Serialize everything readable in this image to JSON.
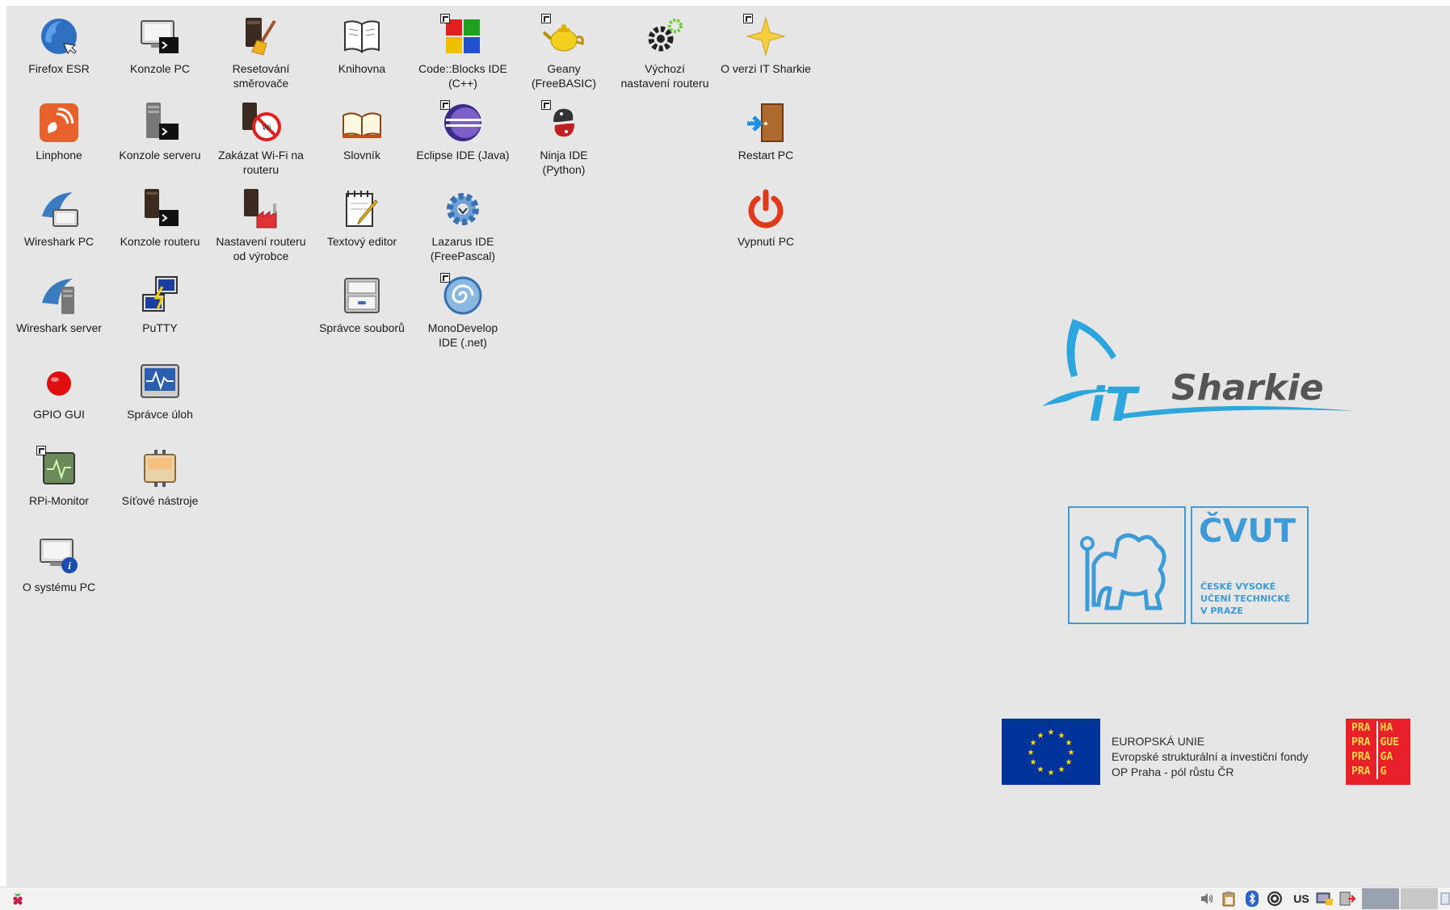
{
  "desktop": {
    "icons": [
      {
        "id": "firefox",
        "label": "Firefox ESR",
        "icon": "firefox-icon"
      },
      {
        "id": "console-pc",
        "label": "Konzole PC",
        "icon": "monitor-terminal-icon"
      },
      {
        "id": "reset-router",
        "label": "Resetování\nsměrovače",
        "icon": "router-broom-icon"
      },
      {
        "id": "library",
        "label": "Knihovna",
        "icon": "book-icon"
      },
      {
        "id": "codeblocks",
        "label": "Code::Blocks IDE\n(C++)",
        "icon": "codeblocks-icon"
      },
      {
        "id": "geany",
        "label": "Geany\n(FreeBASIC)",
        "icon": "teapot-icon"
      },
      {
        "id": "default-router",
        "label": "Výchozí\nnastavení routeru",
        "icon": "gears-icon"
      },
      {
        "id": "about-it-sharkie",
        "label": "O verzi IT Sharkie",
        "icon": "star-icon"
      },
      {
        "id": "linphone",
        "label": "Linphone",
        "icon": "linphone-icon"
      },
      {
        "id": "console-server",
        "label": "Konzole serveru",
        "icon": "server-terminal-icon"
      },
      {
        "id": "disable-wifi",
        "label": "Zakázat Wi-Fi na\nrouteru",
        "icon": "wifi-off-icon"
      },
      {
        "id": "dictionary",
        "label": "Slovník",
        "icon": "open-book-icon"
      },
      {
        "id": "eclipse",
        "label": "Eclipse IDE (Java)",
        "icon": "eclipse-icon"
      },
      {
        "id": "ninja",
        "label": "Ninja IDE\n(Python)",
        "icon": "python-icon"
      },
      {
        "id": "restart",
        "label": "Restart PC",
        "icon": "door-exit-icon"
      },
      {
        "id": "wireshark-pc",
        "label": "Wireshark PC",
        "icon": "wireshark-fin-icon"
      },
      {
        "id": "console-router",
        "label": "Konzole routeru",
        "icon": "router-terminal-icon"
      },
      {
        "id": "router-factory",
        "label": "Nastavení routeru\nod výrobce",
        "icon": "router-factory-icon"
      },
      {
        "id": "text-editor",
        "label": "Textový editor",
        "icon": "notepad-pencil-icon"
      },
      {
        "id": "lazarus",
        "label": "Lazarus IDE\n(FreePascal)",
        "icon": "lazarus-gear-icon"
      },
      {
        "id": "shutdown",
        "label": "Vypnutí PC",
        "icon": "power-icon"
      },
      {
        "id": "wireshark-server",
        "label": "Wireshark server",
        "icon": "wireshark-server-icon"
      },
      {
        "id": "putty",
        "label": "PuTTY",
        "icon": "putty-icon"
      },
      {
        "id": "file-manager",
        "label": "Správce souborů",
        "icon": "file-cabinet-icon"
      },
      {
        "id": "monodevelop",
        "label": "MonoDevelop\nIDE (.net)",
        "icon": "monodevelop-icon"
      },
      {
        "id": "gpio",
        "label": "GPIO GUI",
        "icon": "red-dot-icon"
      },
      {
        "id": "task-manager",
        "label": "Správce úloh",
        "icon": "pulse-monitor-icon"
      },
      {
        "id": "rpi-monitor",
        "label": "RPi-Monitor",
        "icon": "chip-pulse-icon"
      },
      {
        "id": "network-tools",
        "label": "Síťové nástroje",
        "icon": "network-tools-icon"
      },
      {
        "id": "about-system",
        "label": "O systému PC",
        "icon": "monitor-info-icon"
      }
    ]
  },
  "branding": {
    "it_sharkie": {
      "prefix": "iT",
      "name": "Sharkie"
    },
    "cvut": {
      "title": "ČVUT",
      "line1": "ČESKÉ VYSOKÉ",
      "line2": "UČENÍ TECHNICKÉ",
      "line3": "V PRAZE"
    },
    "eu": {
      "line1": "EUROPSKÁ UNIE",
      "line2": "Evropské strukturální a investiční fondy",
      "line3": "OP Praha - pól růstu ČR"
    },
    "praha_tiles": [
      [
        "PRA",
        "HA"
      ],
      [
        "PRA",
        "GUE"
      ],
      [
        "PRA",
        "GA"
      ],
      [
        "PRA",
        "G"
      ]
    ]
  },
  "taskbar": {
    "menu_icon": "raspberry-icon",
    "tray": {
      "keyboard_layout": "US"
    }
  },
  "colors": {
    "desktop_bg": "#e6e6e6",
    "brand_blue": "#2ca6dc",
    "eu_blue": "#003399",
    "praha_red": "#e8202a"
  }
}
